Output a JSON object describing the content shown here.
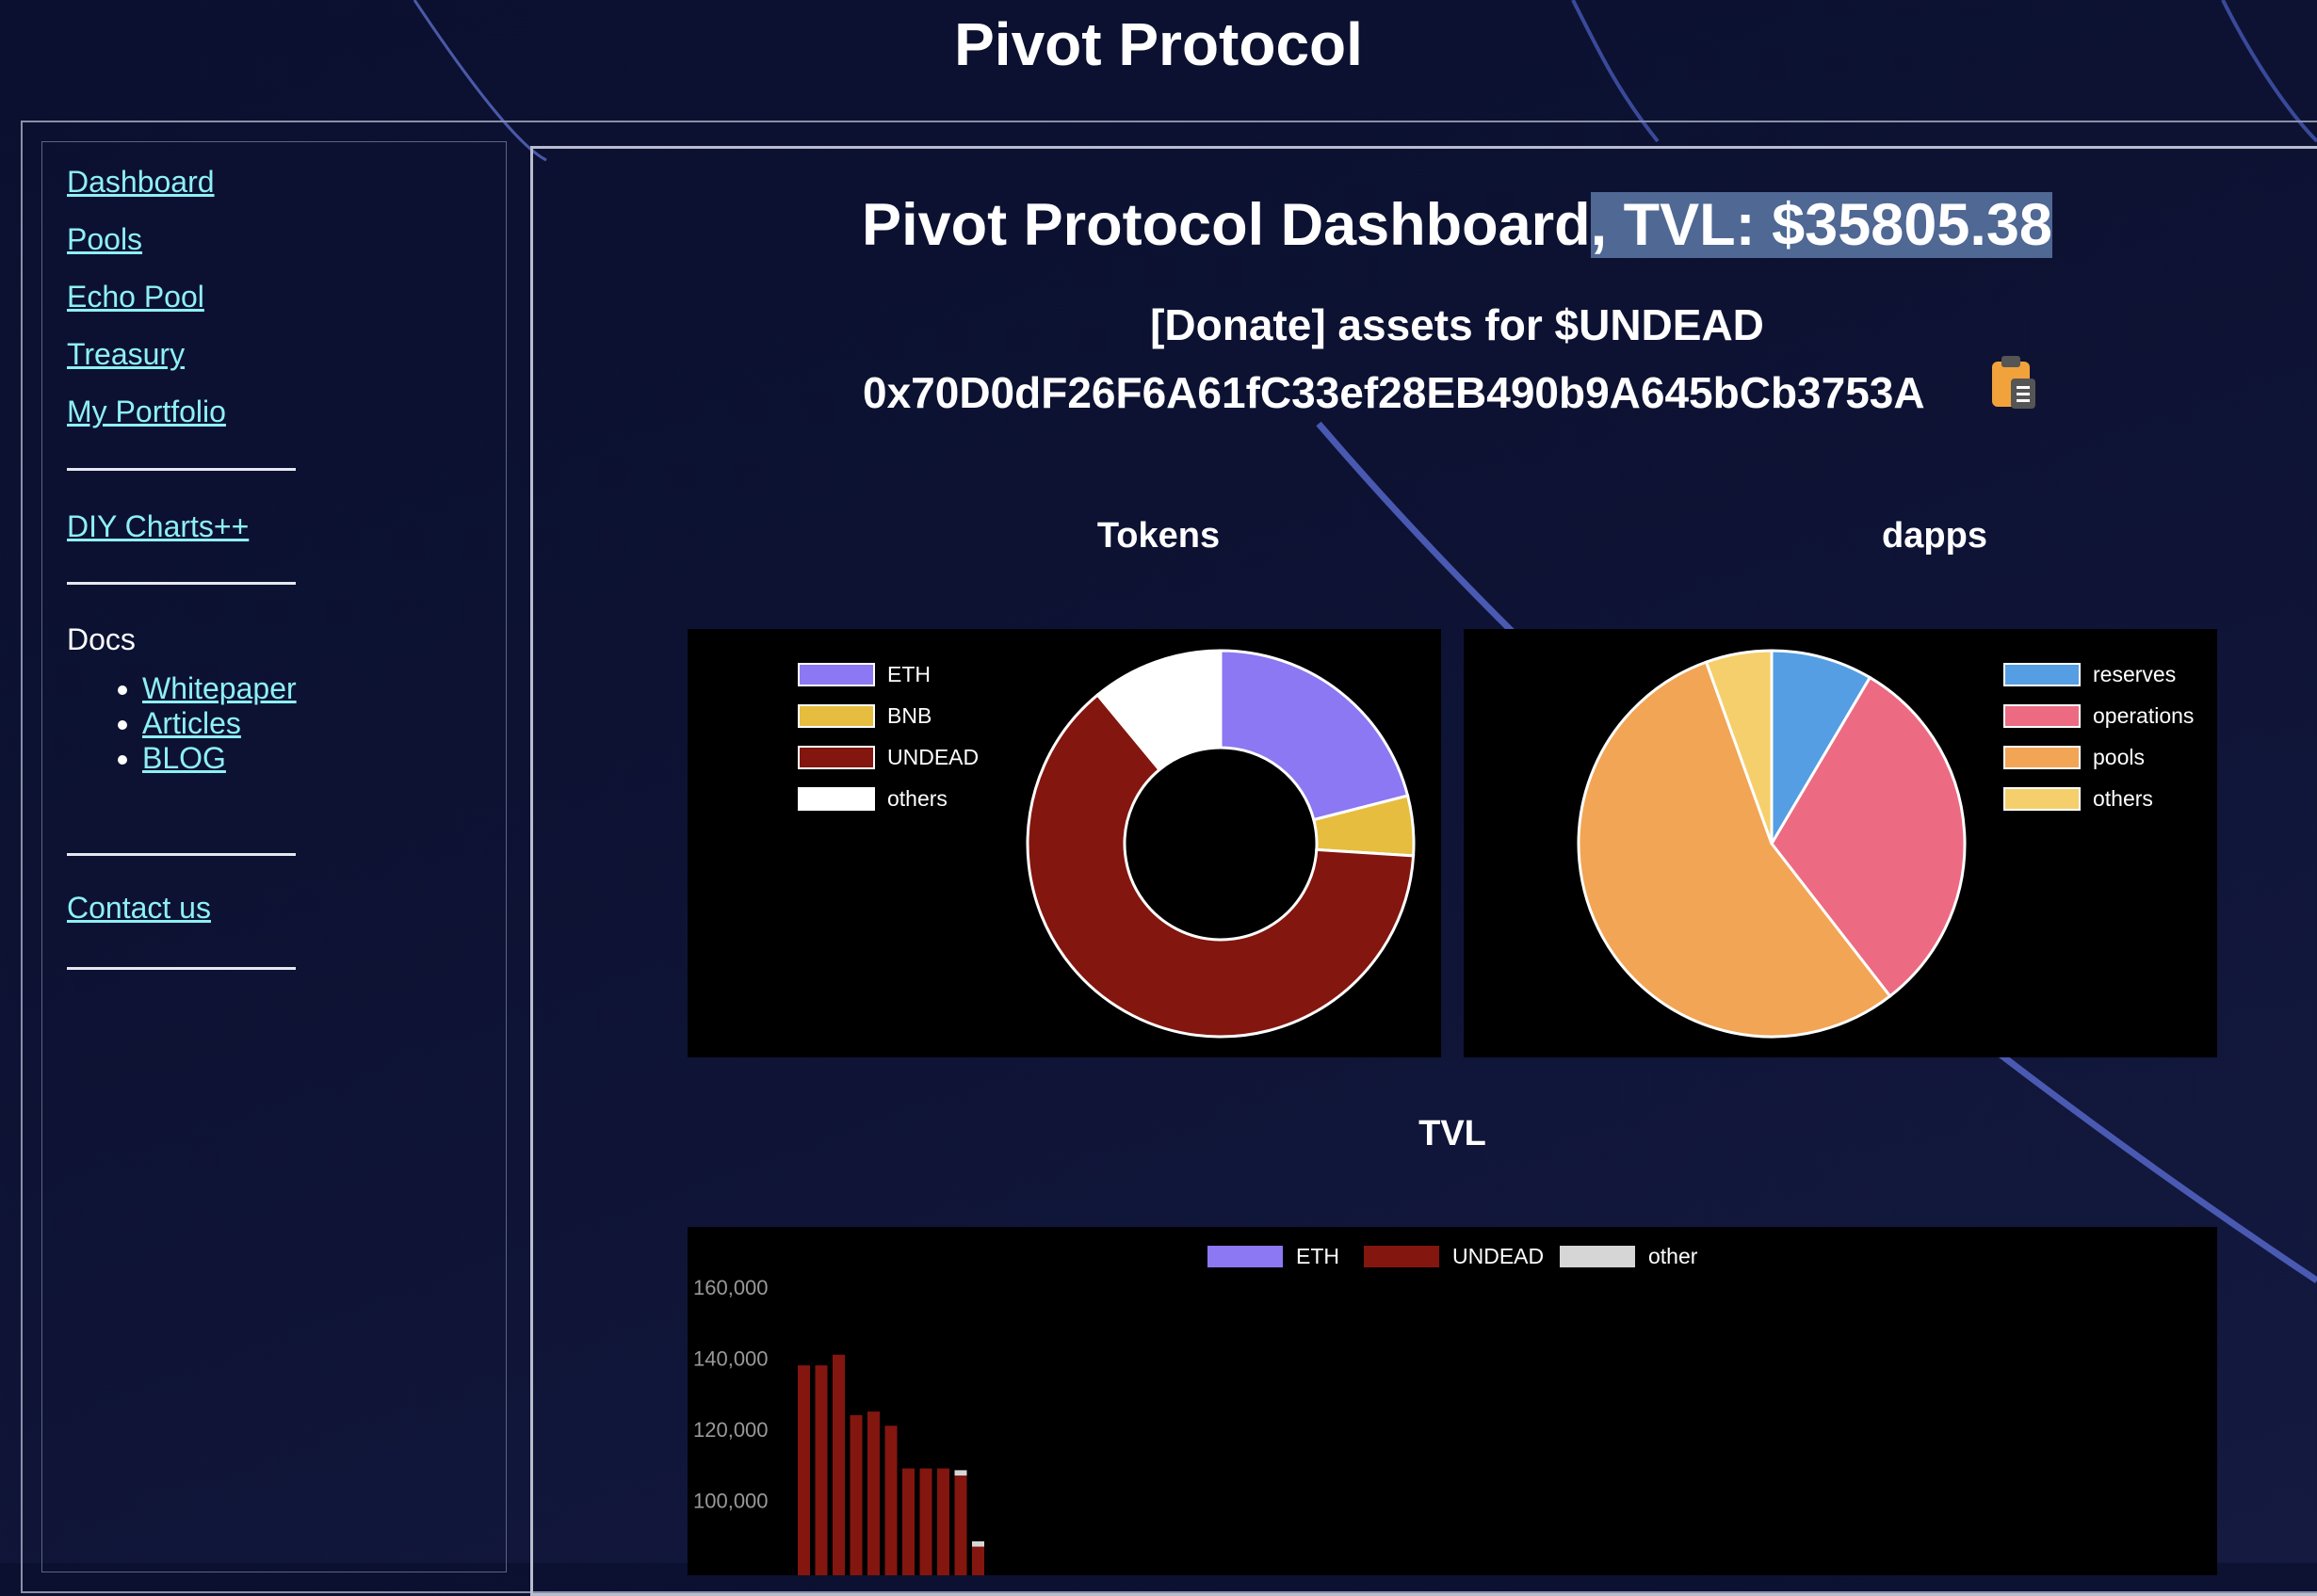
{
  "site": {
    "title": "Pivot Protocol"
  },
  "sidebar": {
    "links": [
      {
        "label": "Dashboard"
      },
      {
        "label": "Pools"
      },
      {
        "label": "Echo Pool"
      },
      {
        "label": "Treasury"
      },
      {
        "label": "My Portfolio"
      },
      {
        "label": "DIY Charts++"
      },
      {
        "label": "Contact us"
      }
    ],
    "docs_label": "Docs",
    "docs_items": [
      {
        "label": "Whitepaper"
      },
      {
        "label": "Articles"
      },
      {
        "label": "BLOG"
      }
    ]
  },
  "main": {
    "title_prefix": "Pivot Protocol Dashboard",
    "title_tvl": ", TVL: $35805.38",
    "donate_text": "[Donate] assets for $UNDEAD",
    "address": "0x70D0dF26F6A61fC33ef28EB490b9A645bCb3753A",
    "clipboard_icon": "clipboard-icon"
  },
  "chart_data": [
    {
      "type": "pie",
      "title": "Tokens",
      "donut": true,
      "categories": [
        "ETH",
        "BNB",
        "UNDEAD",
        "others"
      ],
      "values": [
        21,
        5,
        63,
        11
      ],
      "colors": [
        "#8b78f2",
        "#e6bd3e",
        "#83160f",
        "#ffffff"
      ]
    },
    {
      "type": "pie",
      "title": "dapps",
      "donut": false,
      "categories": [
        "reserves",
        "operations",
        "pools",
        "others"
      ],
      "values": [
        8.5,
        31,
        55,
        5.5
      ],
      "colors": [
        "#559ee3",
        "#ec6b82",
        "#f2a555",
        "#f5cf6b"
      ]
    },
    {
      "type": "bar",
      "title": "TVL",
      "stacked": true,
      "series": [
        {
          "name": "ETH",
          "color": "#8b78f2",
          "values": [
            0,
            0,
            0,
            0,
            0,
            0,
            0,
            0,
            0,
            0,
            0
          ]
        },
        {
          "name": "UNDEAD",
          "color": "#83160f",
          "values": [
            138000,
            138000,
            141000,
            124000,
            125000,
            121000,
            109000,
            109000,
            109000,
            107000,
            87000
          ]
        },
        {
          "name": "other",
          "color": "#d6d6d6",
          "values": [
            0,
            0,
            0,
            0,
            0,
            0,
            0,
            0,
            0,
            1500,
            1500
          ]
        }
      ],
      "ylim": [
        80000,
        160000
      ],
      "yticks": [
        "160,000",
        "140,000",
        "120,000",
        "100,000"
      ],
      "yticks_values": [
        160000,
        140000,
        120000,
        100000
      ]
    }
  ]
}
